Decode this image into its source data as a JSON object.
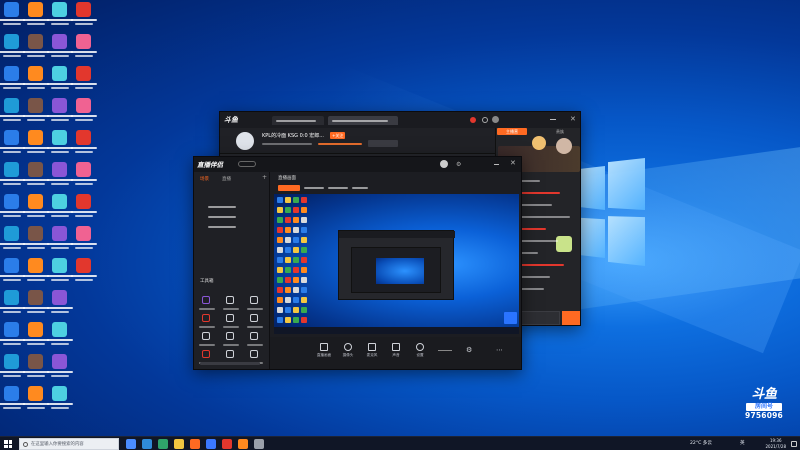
{
  "taskbar": {
    "search_placeholder": "在这里输入你要搜索的内容",
    "weather": "22°C 多云",
    "ime": "英",
    "clock_time": "19:36",
    "clock_date": "2021/7/28"
  },
  "watermark": {
    "logo": "斗鱼",
    "room_label": "房间号",
    "room_number": "9756096"
  },
  "back_window": {
    "app_logo": "斗鱼",
    "stream_title": "KPL的冷面 KSG 0:0 宏郎...",
    "follow_label": "+关注",
    "chat_tabs": [
      "主播营",
      "贵族"
    ]
  },
  "front_window": {
    "app_logo": "直播伴侣",
    "scene_tabs": [
      "场景",
      "直播"
    ],
    "source_title": "直播画面",
    "tools_title": "工具箱",
    "toolbar": [
      "直播画面",
      "摄像头",
      "录音",
      "分屏",
      "设置",
      "美颜"
    ],
    "toolbar_items": [
      {
        "label": "直播画面"
      },
      {
        "label": "摄像头"
      },
      {
        "label": "麦克风"
      },
      {
        "label": "声音"
      },
      {
        "label": "设置"
      }
    ]
  },
  "colors": {
    "douyu_orange": "#ff6a22",
    "accent_red": "#e2372d",
    "windows_blue": "#0e6fe0"
  }
}
